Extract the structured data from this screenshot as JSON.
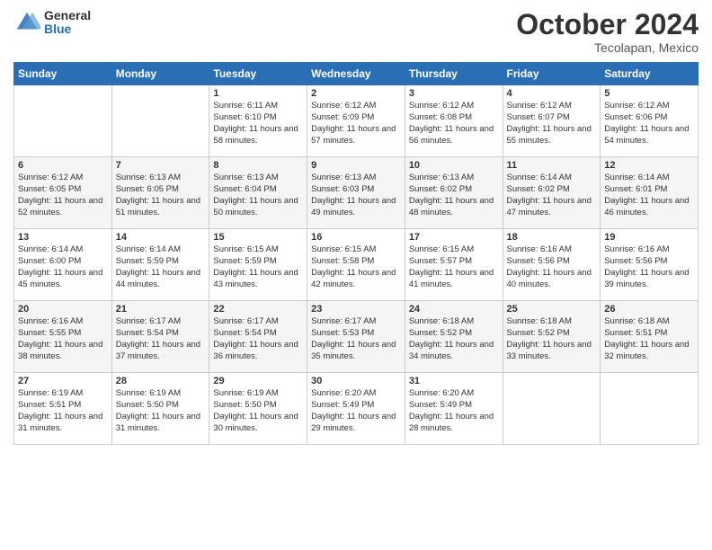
{
  "logo": {
    "general": "General",
    "blue": "Blue"
  },
  "title": "October 2024",
  "location": "Tecolapan, Mexico",
  "days_of_week": [
    "Sunday",
    "Monday",
    "Tuesday",
    "Wednesday",
    "Thursday",
    "Friday",
    "Saturday"
  ],
  "weeks": [
    [
      {
        "day": null
      },
      {
        "day": null
      },
      {
        "day": "1",
        "sunrise": "Sunrise: 6:11 AM",
        "sunset": "Sunset: 6:10 PM",
        "daylight": "Daylight: 11 hours and 58 minutes."
      },
      {
        "day": "2",
        "sunrise": "Sunrise: 6:12 AM",
        "sunset": "Sunset: 6:09 PM",
        "daylight": "Daylight: 11 hours and 57 minutes."
      },
      {
        "day": "3",
        "sunrise": "Sunrise: 6:12 AM",
        "sunset": "Sunset: 6:08 PM",
        "daylight": "Daylight: 11 hours and 56 minutes."
      },
      {
        "day": "4",
        "sunrise": "Sunrise: 6:12 AM",
        "sunset": "Sunset: 6:07 PM",
        "daylight": "Daylight: 11 hours and 55 minutes."
      },
      {
        "day": "5",
        "sunrise": "Sunrise: 6:12 AM",
        "sunset": "Sunset: 6:06 PM",
        "daylight": "Daylight: 11 hours and 54 minutes."
      }
    ],
    [
      {
        "day": "6",
        "sunrise": "Sunrise: 6:12 AM",
        "sunset": "Sunset: 6:05 PM",
        "daylight": "Daylight: 11 hours and 52 minutes."
      },
      {
        "day": "7",
        "sunrise": "Sunrise: 6:13 AM",
        "sunset": "Sunset: 6:05 PM",
        "daylight": "Daylight: 11 hours and 51 minutes."
      },
      {
        "day": "8",
        "sunrise": "Sunrise: 6:13 AM",
        "sunset": "Sunset: 6:04 PM",
        "daylight": "Daylight: 11 hours and 50 minutes."
      },
      {
        "day": "9",
        "sunrise": "Sunrise: 6:13 AM",
        "sunset": "Sunset: 6:03 PM",
        "daylight": "Daylight: 11 hours and 49 minutes."
      },
      {
        "day": "10",
        "sunrise": "Sunrise: 6:13 AM",
        "sunset": "Sunset: 6:02 PM",
        "daylight": "Daylight: 11 hours and 48 minutes."
      },
      {
        "day": "11",
        "sunrise": "Sunrise: 6:14 AM",
        "sunset": "Sunset: 6:02 PM",
        "daylight": "Daylight: 11 hours and 47 minutes."
      },
      {
        "day": "12",
        "sunrise": "Sunrise: 6:14 AM",
        "sunset": "Sunset: 6:01 PM",
        "daylight": "Daylight: 11 hours and 46 minutes."
      }
    ],
    [
      {
        "day": "13",
        "sunrise": "Sunrise: 6:14 AM",
        "sunset": "Sunset: 6:00 PM",
        "daylight": "Daylight: 11 hours and 45 minutes."
      },
      {
        "day": "14",
        "sunrise": "Sunrise: 6:14 AM",
        "sunset": "Sunset: 5:59 PM",
        "daylight": "Daylight: 11 hours and 44 minutes."
      },
      {
        "day": "15",
        "sunrise": "Sunrise: 6:15 AM",
        "sunset": "Sunset: 5:59 PM",
        "daylight": "Daylight: 11 hours and 43 minutes."
      },
      {
        "day": "16",
        "sunrise": "Sunrise: 6:15 AM",
        "sunset": "Sunset: 5:58 PM",
        "daylight": "Daylight: 11 hours and 42 minutes."
      },
      {
        "day": "17",
        "sunrise": "Sunrise: 6:15 AM",
        "sunset": "Sunset: 5:57 PM",
        "daylight": "Daylight: 11 hours and 41 minutes."
      },
      {
        "day": "18",
        "sunrise": "Sunrise: 6:16 AM",
        "sunset": "Sunset: 5:56 PM",
        "daylight": "Daylight: 11 hours and 40 minutes."
      },
      {
        "day": "19",
        "sunrise": "Sunrise: 6:16 AM",
        "sunset": "Sunset: 5:56 PM",
        "daylight": "Daylight: 11 hours and 39 minutes."
      }
    ],
    [
      {
        "day": "20",
        "sunrise": "Sunrise: 6:16 AM",
        "sunset": "Sunset: 5:55 PM",
        "daylight": "Daylight: 11 hours and 38 minutes."
      },
      {
        "day": "21",
        "sunrise": "Sunrise: 6:17 AM",
        "sunset": "Sunset: 5:54 PM",
        "daylight": "Daylight: 11 hours and 37 minutes."
      },
      {
        "day": "22",
        "sunrise": "Sunrise: 6:17 AM",
        "sunset": "Sunset: 5:54 PM",
        "daylight": "Daylight: 11 hours and 36 minutes."
      },
      {
        "day": "23",
        "sunrise": "Sunrise: 6:17 AM",
        "sunset": "Sunset: 5:53 PM",
        "daylight": "Daylight: 11 hours and 35 minutes."
      },
      {
        "day": "24",
        "sunrise": "Sunrise: 6:18 AM",
        "sunset": "Sunset: 5:52 PM",
        "daylight": "Daylight: 11 hours and 34 minutes."
      },
      {
        "day": "25",
        "sunrise": "Sunrise: 6:18 AM",
        "sunset": "Sunset: 5:52 PM",
        "daylight": "Daylight: 11 hours and 33 minutes."
      },
      {
        "day": "26",
        "sunrise": "Sunrise: 6:18 AM",
        "sunset": "Sunset: 5:51 PM",
        "daylight": "Daylight: 11 hours and 32 minutes."
      }
    ],
    [
      {
        "day": "27",
        "sunrise": "Sunrise: 6:19 AM",
        "sunset": "Sunset: 5:51 PM",
        "daylight": "Daylight: 11 hours and 31 minutes."
      },
      {
        "day": "28",
        "sunrise": "Sunrise: 6:19 AM",
        "sunset": "Sunset: 5:50 PM",
        "daylight": "Daylight: 11 hours and 31 minutes."
      },
      {
        "day": "29",
        "sunrise": "Sunrise: 6:19 AM",
        "sunset": "Sunset: 5:50 PM",
        "daylight": "Daylight: 11 hours and 30 minutes."
      },
      {
        "day": "30",
        "sunrise": "Sunrise: 6:20 AM",
        "sunset": "Sunset: 5:49 PM",
        "daylight": "Daylight: 11 hours and 29 minutes."
      },
      {
        "day": "31",
        "sunrise": "Sunrise: 6:20 AM",
        "sunset": "Sunset: 5:49 PM",
        "daylight": "Daylight: 11 hours and 28 minutes."
      },
      {
        "day": null
      },
      {
        "day": null
      }
    ]
  ]
}
